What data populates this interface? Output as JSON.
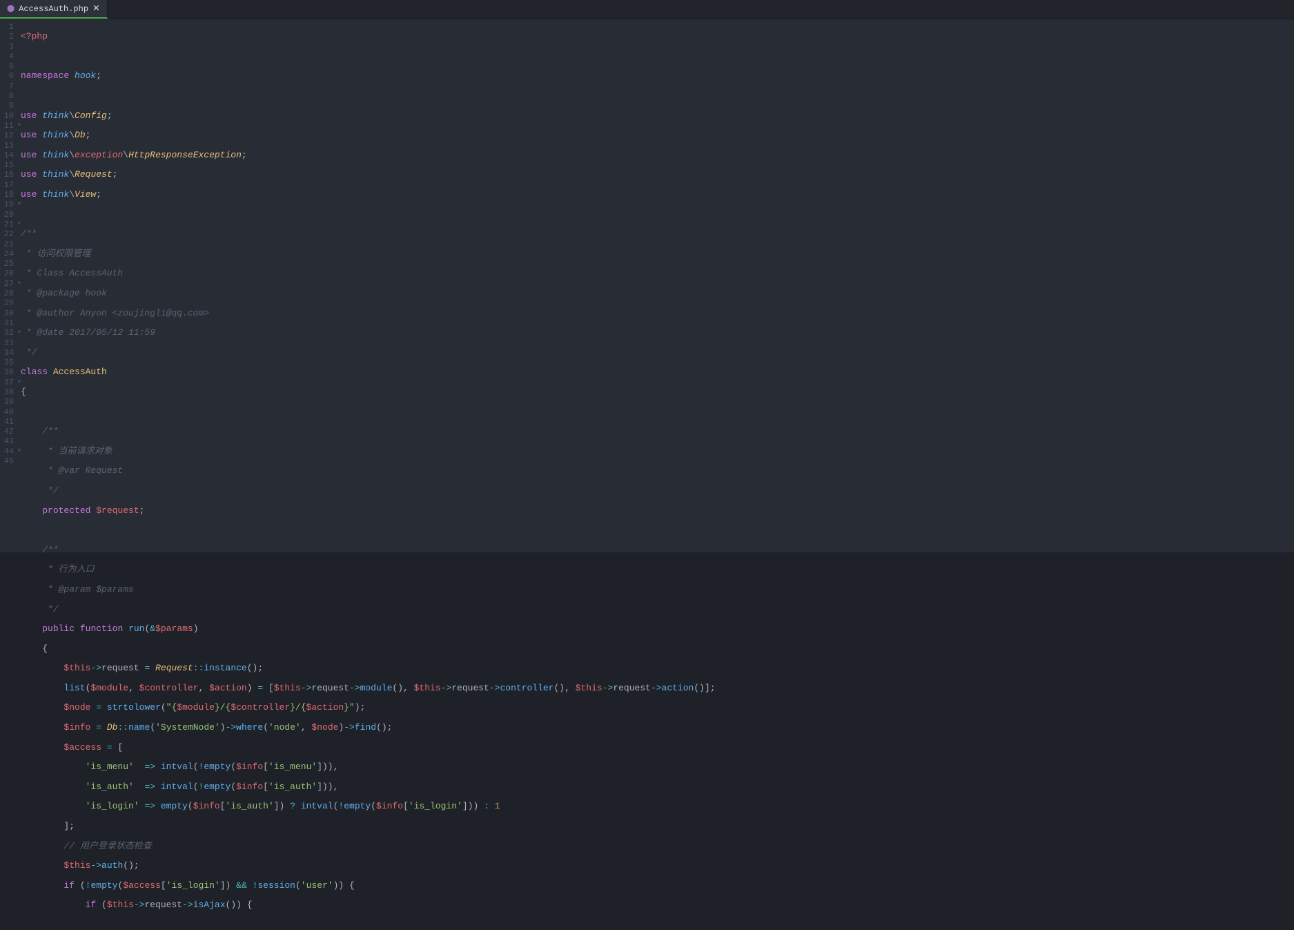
{
  "tab": {
    "filename": "AccessAuth.php",
    "icon": "⬤",
    "close": "✕"
  },
  "gutter_lines": 45,
  "fold_lines": [
    11,
    19,
    21,
    27,
    32,
    37,
    44
  ],
  "code": {
    "l1_open": "<?php",
    "l3_ns_kw": "namespace",
    "l3_ns_name": "hook",
    "l3_semi": ";",
    "l5_use": "use",
    "l5_a": "think",
    "l5_b": "Config",
    "l6_use": "use",
    "l6_a": "think",
    "l6_b": "Db",
    "l7_use": "use",
    "l7_a": "think",
    "l7_b": "exception",
    "l7_c": "HttpResponseException",
    "l8_use": "use",
    "l8_a": "think",
    "l8_b": "Request",
    "l9_use": "use",
    "l9_a": "think",
    "l9_b": "View",
    "c11": "/**",
    "c12": " * 访问权限管理",
    "c13": " * Class AccessAuth",
    "c14": " * @package hook",
    "c15": " * @author Anyon <zoujingli@qq.com>",
    "c16": " * @date 2017/05/12 11:59",
    "c17": " */",
    "l18_class": "class",
    "l18_name": "AccessAuth",
    "l19_brace": "{",
    "c21": "    /**",
    "c22": "     * 当前请求对象",
    "c23": "     * @var Request",
    "c24": "     */",
    "l25_protected": "protected",
    "l25_var": "$request",
    "c27": "    /**",
    "c28": "     * 行为入口",
    "c29": "     * @param $params",
    "c30": "     */",
    "l31_public": "public",
    "l31_function": "function",
    "l31_fn": "run",
    "l31_amp": "&",
    "l31_param": "$params",
    "l32_brace": "{",
    "l33_this": "$this",
    "l33_req": "request",
    "l33_cls": "Request",
    "l33_inst": "instance",
    "l34_list": "list",
    "l34_m": "$module",
    "l34_c": "$controller",
    "l34_a": "$action",
    "l34_this1": "$this",
    "l34_r1": "request",
    "l34_f1": "module",
    "l34_this2": "$this",
    "l34_r2": "request",
    "l34_f2": "controller",
    "l34_this3": "$this",
    "l34_r3": "request",
    "l34_f3": "action",
    "l35_node": "$node",
    "l35_strtolower": "strtolower",
    "l35_s1": "\"{",
    "l35_v1": "$module",
    "l35_s2": "}/{",
    "l35_v2": "$controller",
    "l35_s3": "}/{",
    "l35_v3": "$action",
    "l35_s4": "}\"",
    "l36_info": "$info",
    "l36_db": "Db",
    "l36_name": "name",
    "l36_sn": "'SystemNode'",
    "l36_where": "where",
    "l36_nk": "'node'",
    "l36_nv": "$node",
    "l36_find": "find",
    "l37_access": "$access",
    "l37_open": "[",
    "l38_key": "'is_menu'",
    "l38_arrow": "=>",
    "l38_intval": "intval",
    "l38_empty": "empty",
    "l38_info": "$info",
    "l38_idx": "'is_menu'",
    "l39_key": "'is_auth'",
    "l39_arrow": "=>",
    "l39_intval": "intval",
    "l39_empty": "empty",
    "l39_info": "$info",
    "l39_idx": "'is_auth'",
    "l40_key": "'is_login'",
    "l40_arrow": "=>",
    "l40_empty": "empty",
    "l40_info1": "$info",
    "l40_idx1": "'is_auth'",
    "l40_q": "?",
    "l40_intval": "intval",
    "l40_empty2": "empty",
    "l40_info2": "$info",
    "l40_idx2": "'is_login'",
    "l40_colon": ":",
    "l40_one": "1",
    "l41_close": "];",
    "c42": "        // 用户登录状态检查",
    "l43_this": "$this",
    "l43_auth": "auth",
    "l44_if": "if",
    "l44_empty": "empty",
    "l44_access": "$access",
    "l44_idx": "'is_login'",
    "l44_and": "&&",
    "l44_sess": "session",
    "l44_user": "'user'",
    "l45_if": "if",
    "l45_this": "$this",
    "l45_req": "request",
    "l45_isajax": "isAjax"
  }
}
